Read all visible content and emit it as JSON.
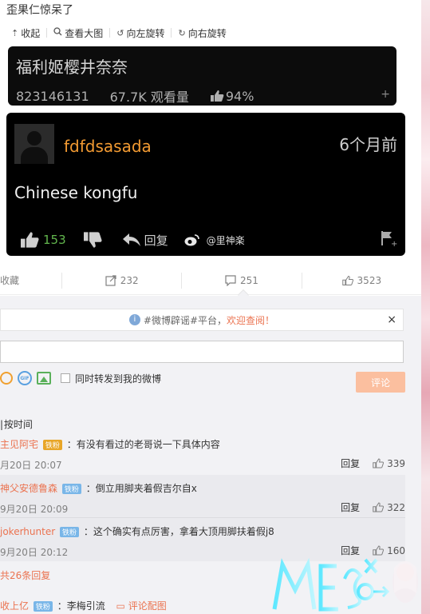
{
  "post_text": "歪果仁惊呆了",
  "toolbar": {
    "collapse": "收起",
    "view_large": "查看大图",
    "rotate_left": "向左旋转",
    "rotate_right": "向右旋转"
  },
  "embed_video": {
    "title": "福利姬樱井奈奈",
    "video_id": "823146131",
    "views": "67.7K 观看量",
    "like_percent": "94%"
  },
  "embed_comment": {
    "user": "fdfdsasada",
    "time": "6个月前",
    "text": "Chinese kongfu",
    "likes": "153",
    "reply_label": "回复",
    "watermark": "@里神楽"
  },
  "stats": {
    "favorite": "收藏",
    "reposts": "232",
    "comments": "251",
    "likes": "3523"
  },
  "notice": {
    "prefix": "#微博辟谣#平台，",
    "link": "欢迎查阅！"
  },
  "composer": {
    "repost_label": "同时转发到我的微博",
    "submit": "评论"
  },
  "sort": {
    "label": "按时间"
  },
  "comments": [
    {
      "user": "主见阿宅",
      "badge": "铁粉",
      "text": "：有没有看过的老哥说一下具体内容",
      "time": "月20日 20:07",
      "reply": "回复",
      "likes": "339"
    },
    {
      "user": "神父安德鲁森",
      "badge": "铁粉",
      "text": "：倒立用脚夹着假吉尔自x",
      "time": "9月20日 20:09",
      "reply": "回复",
      "likes": "322"
    },
    {
      "user": "jokerhunter",
      "badge": "铁粉",
      "text": "：这个确实有点厉害，拿着大顶用脚扶着假j8",
      "time": "9月20日 20:12",
      "reply": "回复",
      "likes": "160"
    }
  ],
  "more_replies": "共26条回复",
  "last_comment": {
    "user": "收上亿",
    "badge": "铁粉",
    "text": "：李梅引流",
    "link": "评论配图"
  },
  "colors": {
    "accent": "#eb7350",
    "badge": "#79b6e8",
    "submit": "#fbbf9f",
    "like_green": "#62b64d",
    "username_orange": "#f29a32"
  }
}
